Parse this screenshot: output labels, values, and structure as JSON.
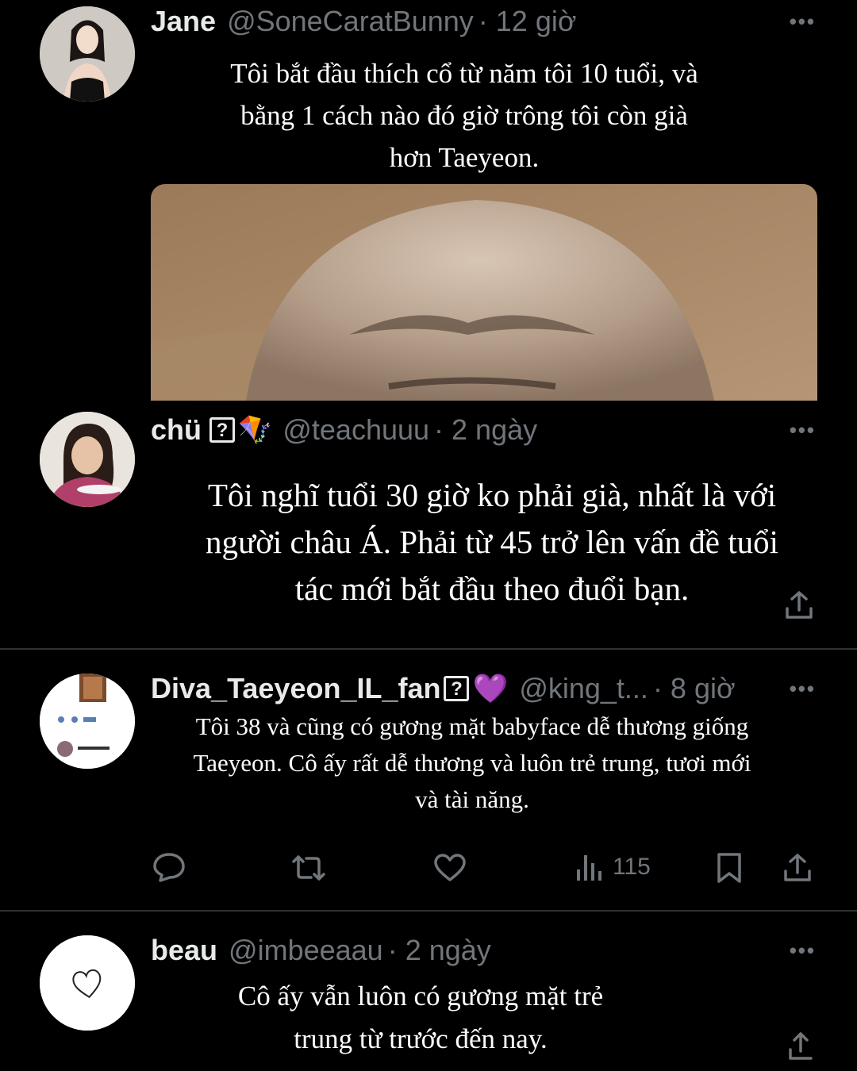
{
  "tweets": [
    {
      "name": "Jane",
      "handle": "@SoneCaratBunny",
      "time": "· 12 giờ",
      "text_lines": [
        "Tôi bắt đầu thích cổ từ năm tôi 10 tuổi, và",
        "bằng 1 cách nào đó giờ trông tôi còn già",
        "hơn Taeyeon."
      ],
      "more_icon": "more-dots-icon"
    },
    {
      "name": "chü",
      "name_badge": "?",
      "name_emoji": "🪁",
      "handle": "@teachuuu",
      "time": "· 2 ngày",
      "text_lines": [
        "Tôi nghĩ tuổi 30 giờ ko phải già, nhất là với",
        "người châu Á. Phải từ 45 trở lên vấn đề tuổi",
        "tác mới bắt đầu theo đuổi bạn."
      ],
      "more_icon": "more-dots-icon"
    },
    {
      "name": "Diva_Taeyeon_IL_fan",
      "name_badge": "?",
      "name_emoji": "💜",
      "handle": "@king_t...",
      "time": "· 8 giờ",
      "text_lines": [
        "Tôi 38 và cũng có gương mặt babyface dễ thương giống",
        "Taeyeon. Cô ấy rất dễ thương và luôn trẻ trung, tươi mới",
        "và tài năng."
      ],
      "views": "115",
      "more_icon": "more-dots-icon"
    },
    {
      "name": "beau",
      "handle": "@imbeeaau",
      "time": "· 2 ngày",
      "text_lines": [
        "Cô ấy vẫn luôn có gương mặt trẻ",
        "trung từ trước đến nay."
      ],
      "more_icon": "more-dots-icon"
    }
  ],
  "colors": {
    "background": "#000000",
    "text": "#e7e9ea",
    "muted": "#71767b",
    "divider": "#2f3336"
  }
}
